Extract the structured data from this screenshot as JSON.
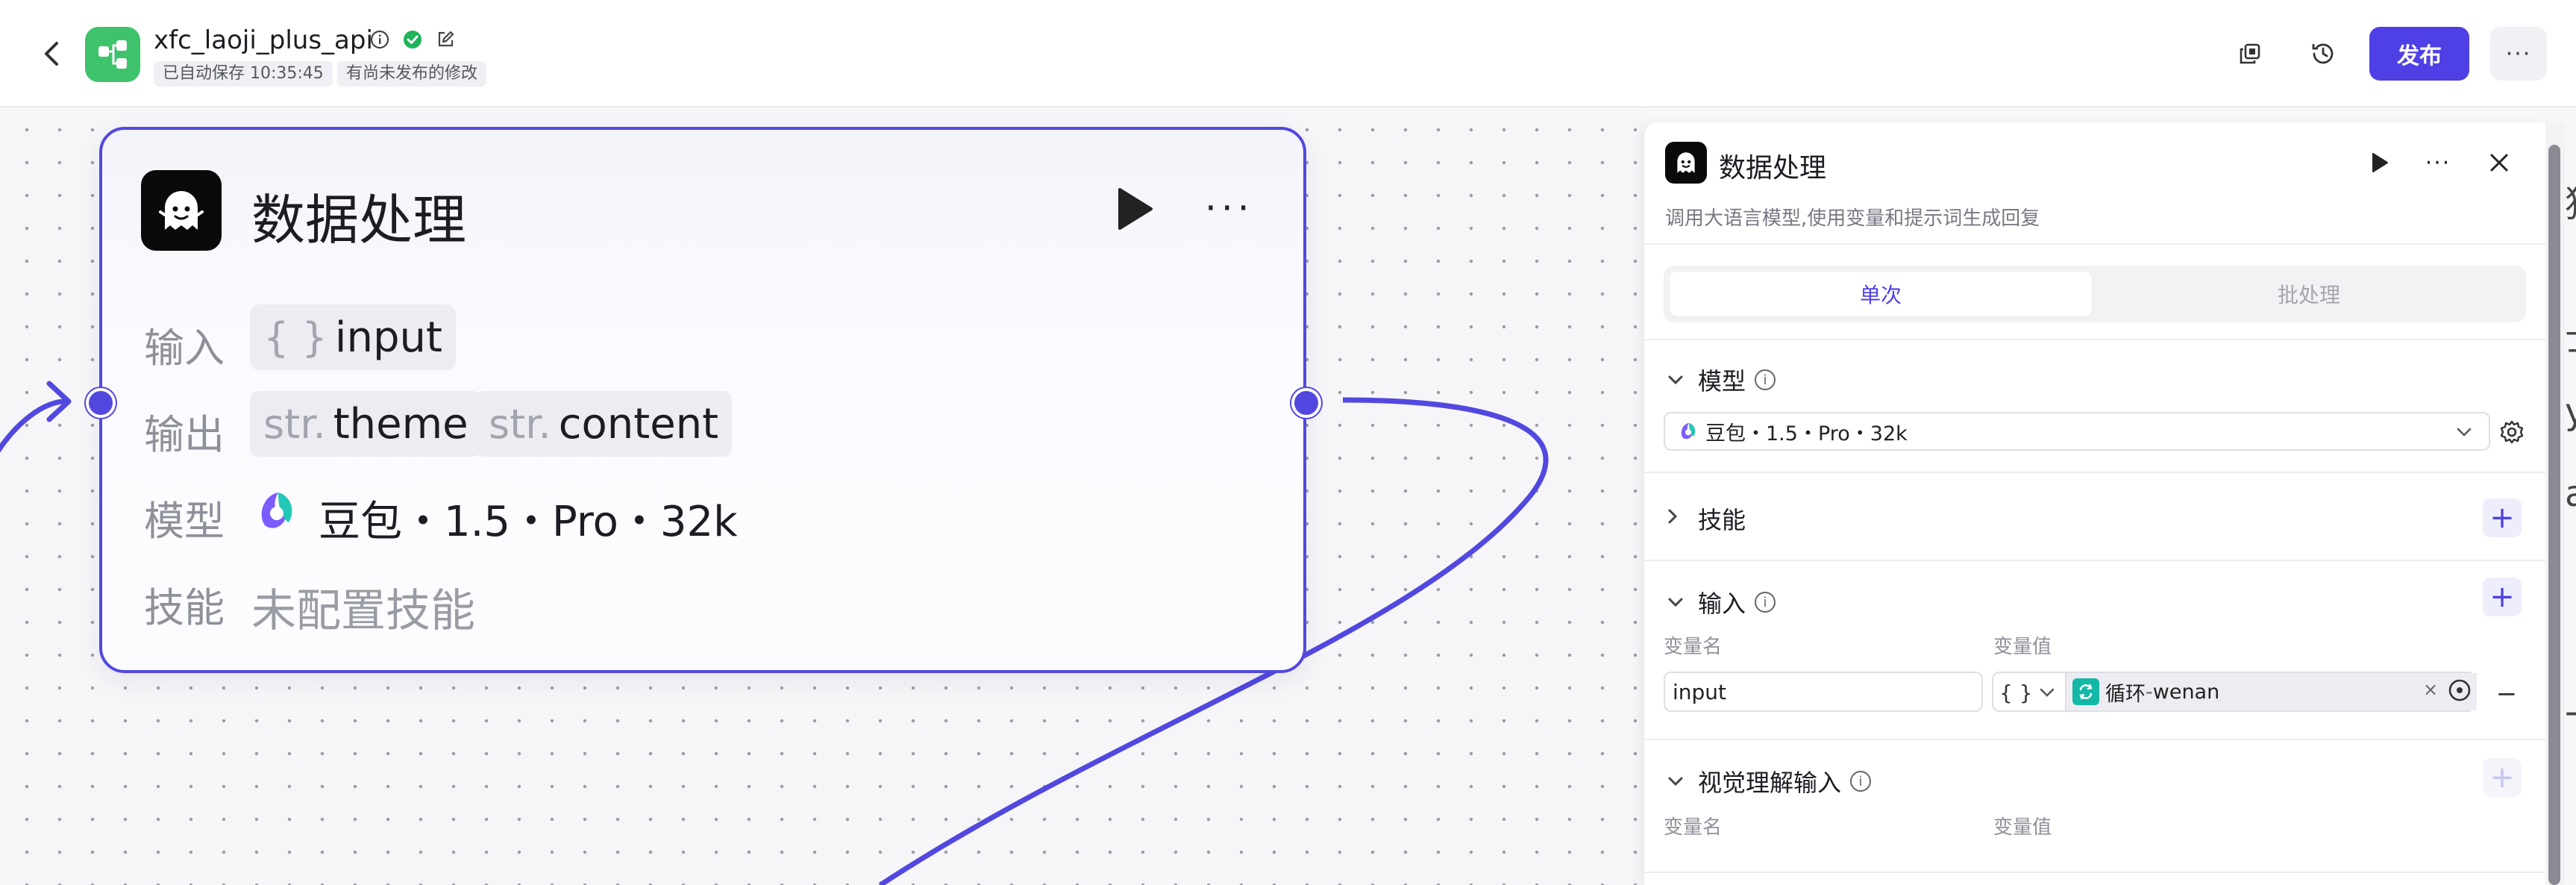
{
  "header": {
    "app_title": "xfc_laoji_plus_api",
    "autosave": "已自动保存 10:35:45",
    "unpublished": "有尚未发布的修改",
    "publish_label": "发布",
    "more_label": "···",
    "back_label": "‹"
  },
  "node": {
    "title": "数据处理",
    "more_label": "···",
    "input_label": "输入",
    "input_chip_prefix": "{ }",
    "input_chip": "input",
    "output_label": "输出",
    "output_chips": [
      {
        "prefix": "str.",
        "name": "theme"
      },
      {
        "prefix": "str.",
        "name": "content"
      }
    ],
    "model_label": "模型",
    "model_value": "豆包・1.5・Pro・32k",
    "skill_label": "技能",
    "skill_value": "未配置技能"
  },
  "panel": {
    "title": "数据处理",
    "subtitle": "调用大语言模型,使用变量和提示词生成回复",
    "tabs": [
      {
        "label": "单次",
        "active": true
      },
      {
        "label": "批处理",
        "active": false
      }
    ],
    "model_section": {
      "label": "模型",
      "selected": "豆包・1.5・Pro・32k"
    },
    "skill_section": {
      "label": "技能"
    },
    "input_section": {
      "label": "输入",
      "col_name": "变量名",
      "col_value": "变量值",
      "row": {
        "name": "input",
        "type": "{ }",
        "ref_source": "循环",
        "ref_sep": " - ",
        "ref_var": "wenan",
        "clear": "×"
      }
    },
    "vision_section": {
      "label": "视觉理解输入",
      "col_name": "变量名",
      "col_value": "变量值"
    },
    "close_label": "✕",
    "more_label": "···",
    "add_label": "+",
    "minus_label": "−"
  },
  "strip": [
    "猜",
    "士",
    "y",
    "a",
    "-"
  ],
  "colors": {
    "accent": "#4e40e5",
    "node_border": "#5248e0",
    "app_logo": "#3ec26b",
    "ref_icon": "#14b8a6"
  },
  "icons": {
    "back": "chevron-left-icon",
    "logo": "workflow-icon",
    "info": "info-icon",
    "check": "check-circle-icon",
    "edit": "edit-icon",
    "copy": "copy-icon",
    "history": "history-icon",
    "node": "ghost-icon",
    "run": "play-icon",
    "gear": "gear-icon",
    "loop": "loop-icon",
    "target": "target-icon"
  }
}
